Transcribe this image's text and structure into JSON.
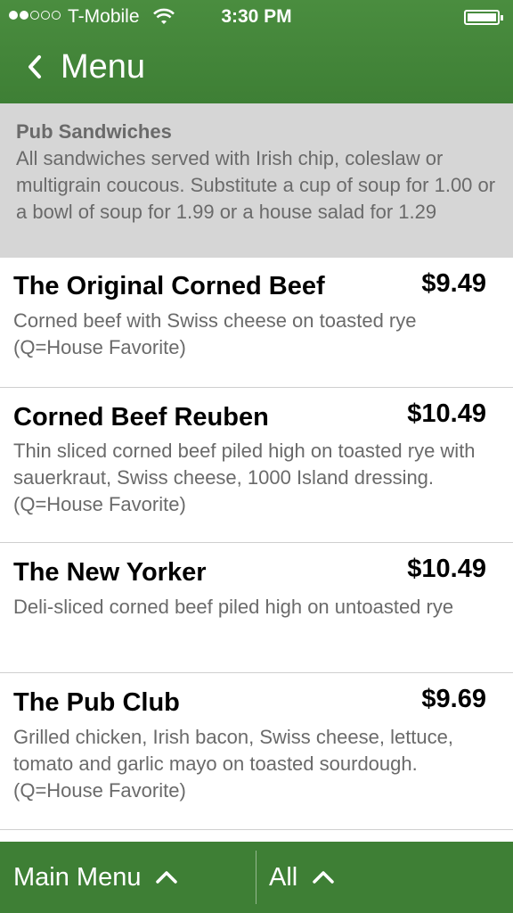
{
  "status_bar": {
    "carrier": "T-Mobile",
    "time": "3:30 PM",
    "signal_bars_filled": 2,
    "signal_bars_total": 5
  },
  "nav": {
    "title": "Menu",
    "back_icon": "chevron-left-icon"
  },
  "section": {
    "title": "Pub Sandwiches",
    "description": "All sandwiches served with Irish chip, coleslaw or multigrain coucous. Substitute a cup of soup for 1.00 or a bowl of soup for 1.99 or a house salad for 1.29"
  },
  "items": [
    {
      "name": "The Original Corned Beef",
      "price": "$9.49",
      "description": "Corned beef with Swiss cheese on toasted rye (Q=House Favorite)"
    },
    {
      "name": "Corned Beef Reuben",
      "price": "$10.49",
      "description": "Thin sliced corned beef piled high on toasted rye with sauerkraut, Swiss cheese, 1000 Island dressing. (Q=House Favorite)"
    },
    {
      "name": "The New Yorker",
      "price": "$10.49",
      "description": "Deli-sliced corned beef piled high on untoasted rye"
    },
    {
      "name": "The Pub Club",
      "price": "$9.69",
      "description": "Grilled chicken, Irish bacon, Swiss cheese, lettuce, tomato and garlic mayo on toasted sourdough. (Q=House Favorite)"
    }
  ],
  "footer": {
    "main_menu_label": "Main Menu",
    "filter_label": "All",
    "chevron_icon": "chevron-up-icon"
  },
  "colors": {
    "header_green": "#4a8d3f",
    "footer_green": "#3e7f35",
    "section_gray": "#d6d6d6",
    "description_gray": "#6a6a6a"
  }
}
